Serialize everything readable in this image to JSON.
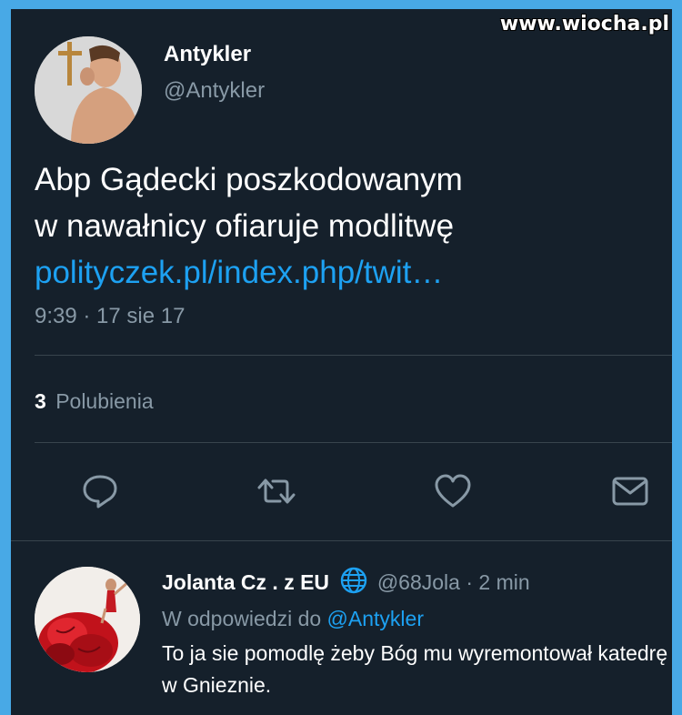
{
  "watermark": "www.wiocha.pl",
  "tweet": {
    "author_name": "Antykler",
    "author_handle": "@Antykler",
    "text_line1": "Abp Gądecki poszkodowanym",
    "text_line2": "w nawałnicy ofiaruje modlitwę",
    "link": "polityczek.pl/index.php/twit…",
    "timestamp": "9:39 · 17 sie 17",
    "likes_count": "3",
    "likes_label": "Polubienia",
    "accent_color": "#1da1f2"
  },
  "actions": [
    {
      "icon": "reply-icon"
    },
    {
      "icon": "retweet-icon"
    },
    {
      "icon": "like-icon"
    },
    {
      "icon": "message-icon"
    }
  ],
  "reply": {
    "author_name": "Jolanta Cz . z EU",
    "author_handle": "@68Jola",
    "separator": "·",
    "time": "2 min",
    "in_reply_prefix": "W odpowiedzi do",
    "in_reply_mention": "@Antykler",
    "text": "To ja sie pomodlę żeby Bóg mu wyremontował katedrę w Gnieznie."
  }
}
